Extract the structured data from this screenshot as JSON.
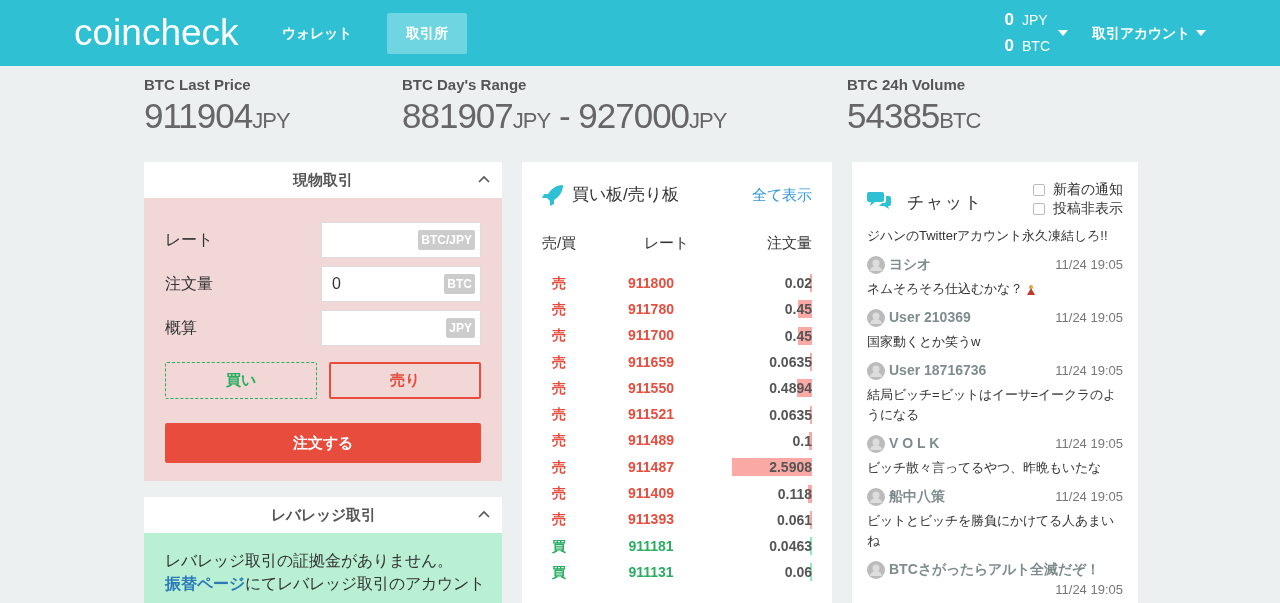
{
  "header": {
    "logo": "coincheck",
    "nav": [
      {
        "label": "ウォレット",
        "selected": false
      },
      {
        "label": "取引所",
        "selected": true
      }
    ],
    "balances": [
      {
        "amount": "0",
        "unit": "JPY"
      },
      {
        "amount": "0",
        "unit": "BTC"
      }
    ],
    "account_menu": "取引アカウント"
  },
  "stats": [
    {
      "label": "BTC Last Price",
      "values": [
        {
          "amount": "911904",
          "unit": "JPY"
        }
      ]
    },
    {
      "label": "BTC Day's Range",
      "separator": "-",
      "values": [
        {
          "amount": "881907",
          "unit": "JPY"
        },
        {
          "amount": "927000",
          "unit": "JPY"
        }
      ]
    },
    {
      "label": "BTC 24h Volume",
      "values": [
        {
          "amount": "54385",
          "unit": "BTC"
        }
      ]
    }
  ],
  "spot": {
    "title": "現物取引",
    "expanded": true,
    "fields": [
      {
        "label": "レート",
        "unit": "BTC/JPY"
      },
      {
        "label": "注文量",
        "value": "0",
        "unit": "BTC"
      },
      {
        "label": "概算",
        "unit": "JPY"
      }
    ],
    "sides": [
      {
        "label": "買い",
        "kind": "buy",
        "selected": false
      },
      {
        "label": "売り",
        "kind": "sell",
        "selected": true
      }
    ],
    "submit": "注文する"
  },
  "leverage": {
    "title": "レバレッジ取引",
    "expanded": true,
    "message": "レバレッジ取引の証拠金がありません。",
    "link": "振替ページ",
    "after_link": "にてレバレッジ取引のアカウント"
  },
  "orderbook": {
    "title": "買い板/売り板",
    "show_all": "全て表示",
    "columns": [
      "売/買",
      "レート",
      "注文量"
    ],
    "rows": [
      {
        "kind": "sell",
        "side_label": "売",
        "rate": "911800",
        "amount": "0.02",
        "level": 0.02
      },
      {
        "kind": "sell",
        "side_label": "売",
        "rate": "911780",
        "amount": "0.45",
        "level": 0.17
      },
      {
        "kind": "sell",
        "side_label": "売",
        "rate": "911700",
        "amount": "0.45",
        "level": 0.17
      },
      {
        "kind": "sell",
        "side_label": "売",
        "rate": "911659",
        "amount": "0.0635",
        "level": 0.03
      },
      {
        "kind": "sell",
        "side_label": "売",
        "rate": "911550",
        "amount": "0.4894",
        "level": 0.19
      },
      {
        "kind": "sell",
        "side_label": "売",
        "rate": "911521",
        "amount": "0.0635",
        "level": 0.03
      },
      {
        "kind": "sell",
        "side_label": "売",
        "rate": "911489",
        "amount": "0.1",
        "level": 0.04
      },
      {
        "kind": "sell",
        "side_label": "売",
        "rate": "911487",
        "amount": "2.5908",
        "level": 1
      },
      {
        "kind": "sell",
        "side_label": "売",
        "rate": "911409",
        "amount": "0.118",
        "level": 0.05
      },
      {
        "kind": "sell",
        "side_label": "売",
        "rate": "911393",
        "amount": "0.061",
        "level": 0.03
      },
      {
        "kind": "buy",
        "side_label": "買",
        "rate": "911181",
        "amount": "0.0463",
        "level": 0.02
      },
      {
        "kind": "buy",
        "side_label": "買",
        "rate": "911131",
        "amount": "0.06",
        "level": 0.03
      }
    ]
  },
  "chat": {
    "title": "チャット",
    "options": [
      {
        "label": "新着の通知",
        "checked": false
      },
      {
        "label": "投稿非表示",
        "checked": false
      }
    ],
    "messages": [
      {
        "text": "ジハンのTwitterアカウント永久凍結しろ!!"
      },
      {
        "user": "ヨシオ",
        "time": "11/24 19:05",
        "text": "ネムそろそろ仕込むかな？",
        "emoji": true
      },
      {
        "user": "User 210369",
        "time": "11/24 19:05",
        "text": "国家動くとか笑うw"
      },
      {
        "user": "User 18716736",
        "time": "11/24 19:05",
        "text": "結局ビッチ=ビットはイーサ=イークラのようになる"
      },
      {
        "user": "V O L K",
        "time": "11/24 19:05",
        "text": "ビッチ散々言ってるやつ、昨晩もいたな"
      },
      {
        "user": "船中八策",
        "time": "11/24 19:05",
        "text": "ビットとビッチを勝負にかけてる人あまいね"
      },
      {
        "user": "BTCさがったらアルト全滅だぞ！",
        "time": "11/24 19:05"
      }
    ]
  }
}
